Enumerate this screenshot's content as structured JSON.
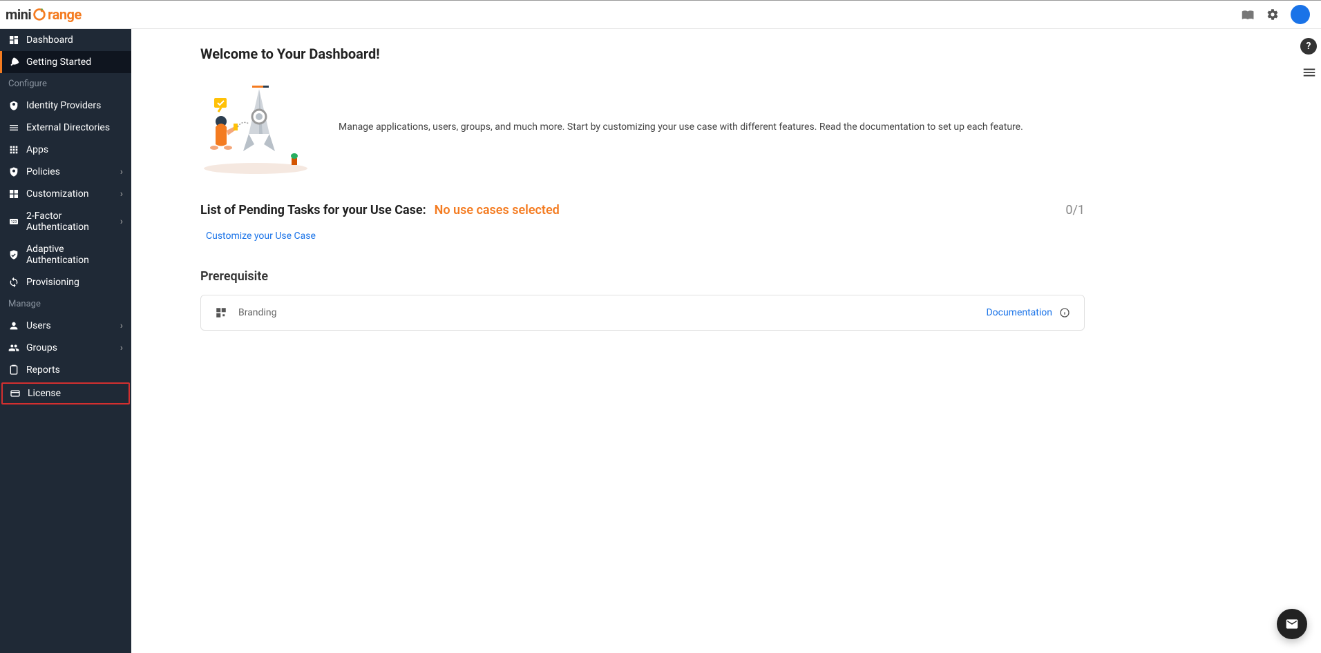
{
  "brand": {
    "part1": "mini",
    "part2": "range"
  },
  "sidebar": {
    "items": [
      {
        "label": "Dashboard"
      },
      {
        "label": "Getting Started"
      }
    ],
    "section_configure": "Configure",
    "configure": [
      {
        "label": "Identity Providers"
      },
      {
        "label": "External Directories"
      },
      {
        "label": "Apps"
      },
      {
        "label": "Policies",
        "chevron": "›"
      },
      {
        "label": "Customization",
        "chevron": "›"
      },
      {
        "label": "2-Factor Authentication",
        "chevron": "›"
      },
      {
        "label": "Adaptive Authentication"
      },
      {
        "label": "Provisioning"
      }
    ],
    "section_manage": "Manage",
    "manage": [
      {
        "label": "Users",
        "chevron": "›"
      },
      {
        "label": "Groups",
        "chevron": "›"
      },
      {
        "label": "Reports"
      },
      {
        "label": "License"
      }
    ]
  },
  "main": {
    "welcome_title": "Welcome to Your Dashboard!",
    "welcome_text": "Manage applications, users, groups, and much more. Start by customizing your use case with different features. Read the documentation to set up each feature.",
    "tasks_title": "List of Pending Tasks for your Use Case:",
    "no_usecase": "No use cases selected",
    "task_count": "0/1",
    "customize": "Customize your Use Case",
    "prereq_title": "Prerequisite",
    "card_label": "Branding",
    "doc_link": "Documentation"
  }
}
